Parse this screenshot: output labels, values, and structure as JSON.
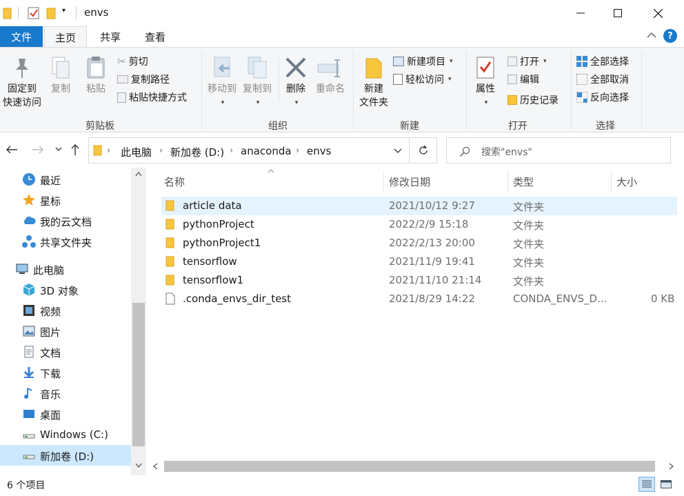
{
  "window": {
    "title": "envs",
    "help_glyph": "?"
  },
  "ribbon_tabs": {
    "file": "文件",
    "home": "主页",
    "share": "共享",
    "view": "查看"
  },
  "clipboard": {
    "group_label": "剪贴板",
    "pin_line1": "固定到",
    "pin_line2": "快速访问",
    "copy": "复制",
    "paste": "粘贴",
    "cut": "剪切",
    "copy_path": "复制路径",
    "paste_shortcut": "粘贴快捷方式"
  },
  "organize": {
    "group_label": "组织",
    "move_to": "移动到",
    "copy_to": "复制到",
    "delete": "删除",
    "rename": "重命名"
  },
  "new_group": {
    "group_label": "新建",
    "new_folder_line1": "新建",
    "new_folder_line2": "文件夹",
    "new_item": "新建项目",
    "easy_access": "轻松访问"
  },
  "open_group": {
    "group_label": "打开",
    "properties": "属性",
    "open": "打开",
    "edit": "编辑",
    "history": "历史记录"
  },
  "select_group": {
    "group_label": "选择",
    "select_all": "全部选择",
    "select_none": "全部取消",
    "invert_selection": "反向选择"
  },
  "address": {
    "crumbs": [
      "此电脑",
      "新加卷 (D:)",
      "anaconda",
      "envs"
    ],
    "search_placeholder": "搜索\"envs\""
  },
  "nav_pane": {
    "items": [
      {
        "label": "最近",
        "icon": "clock-icon"
      },
      {
        "label": "星标",
        "icon": "star-icon"
      },
      {
        "label": "我的云文档",
        "icon": "cloud-icon"
      },
      {
        "label": "共享文件夹",
        "icon": "share-folder-icon"
      },
      {
        "label": "此电脑",
        "icon": "computer-icon"
      },
      {
        "label": "3D 对象",
        "icon": "cube-3d-icon"
      },
      {
        "label": "视频",
        "icon": "video-icon"
      },
      {
        "label": "图片",
        "icon": "picture-icon"
      },
      {
        "label": "文档",
        "icon": "document-icon"
      },
      {
        "label": "下载",
        "icon": "download-icon"
      },
      {
        "label": "音乐",
        "icon": "music-icon"
      },
      {
        "label": "桌面",
        "icon": "desktop-icon"
      },
      {
        "label": "Windows (C:)",
        "icon": "drive-c-icon"
      },
      {
        "label": "新加卷 (D:)",
        "icon": "drive-d-icon"
      }
    ],
    "selected": "新加卷 (D:)"
  },
  "file_list": {
    "columns": {
      "name": "名称",
      "date": "修改日期",
      "type": "类型",
      "size": "大小"
    },
    "rows": [
      {
        "name": "article data",
        "date": "2021/10/12 9:27",
        "type": "文件夹",
        "size": "",
        "kind": "folder",
        "selected": true
      },
      {
        "name": "pythonProject",
        "date": "2022/2/9 15:18",
        "type": "文件夹",
        "size": "",
        "kind": "folder",
        "selected": false
      },
      {
        "name": "pythonProject1",
        "date": "2022/2/13 20:00",
        "type": "文件夹",
        "size": "",
        "kind": "folder",
        "selected": false
      },
      {
        "name": "tensorflow",
        "date": "2021/11/9 19:41",
        "type": "文件夹",
        "size": "",
        "kind": "folder",
        "selected": false
      },
      {
        "name": "tensorflow1",
        "date": "2021/11/10 21:14",
        "type": "文件夹",
        "size": "",
        "kind": "folder",
        "selected": false
      },
      {
        "name": ".conda_envs_dir_test",
        "date": "2021/8/29 14:22",
        "type": "CONDA_ENVS_D...",
        "size": "0 KB",
        "kind": "file",
        "selected": false
      }
    ]
  },
  "status": {
    "item_count": "6 个项目"
  },
  "colors": {
    "accent": "#1979ca",
    "folder": "#f8c63c",
    "selection": "#e5f3ff"
  }
}
